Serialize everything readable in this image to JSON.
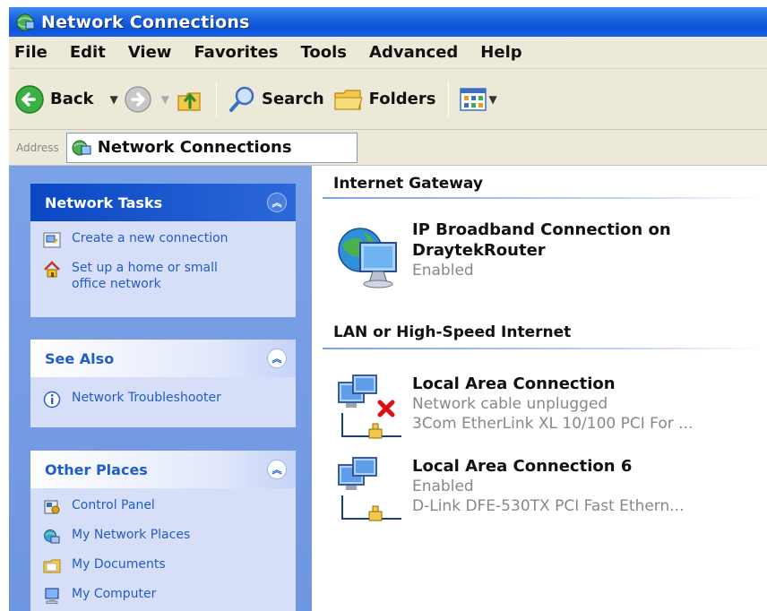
{
  "window": {
    "title": "Network Connections"
  },
  "menu": [
    "File",
    "Edit",
    "View",
    "Favorites",
    "Tools",
    "Advanced",
    "Help"
  ],
  "toolbar": {
    "back_label": "Back",
    "search_label": "Search",
    "folders_label": "Folders"
  },
  "address": {
    "label": "Address",
    "value": "Network Connections"
  },
  "tasks": {
    "network_tasks": {
      "title": "Network Tasks",
      "items": [
        "Create a new connection",
        "Set up a home or small office network"
      ]
    },
    "see_also": {
      "title": "See Also",
      "items": [
        "Network Troubleshooter"
      ]
    },
    "other_places": {
      "title": "Other Places",
      "items": [
        "Control Panel",
        "My Network Places",
        "My Documents",
        "My Computer"
      ]
    }
  },
  "groups": {
    "internet_gateway": {
      "title": "Internet Gateway",
      "connections": [
        {
          "name_line1": "IP Broadband Connection on",
          "name_line2": "DraytekRouter",
          "status": "Enabled"
        }
      ]
    },
    "lan": {
      "title": "LAN or High-Speed Internet",
      "connections": [
        {
          "name": "Local Area Connection",
          "status": "Network cable unplugged",
          "device": "3Com EtherLink XL 10/100 PCI For ..."
        },
        {
          "name": "Local Area Connection 6",
          "status": "Enabled",
          "device": "D-Link DFE-530TX PCI Fast Ethern..."
        }
      ]
    }
  },
  "colors": {
    "title_bar": "#0b54d8",
    "task_pane": "#7ba2e7",
    "link": "#215dc6"
  }
}
